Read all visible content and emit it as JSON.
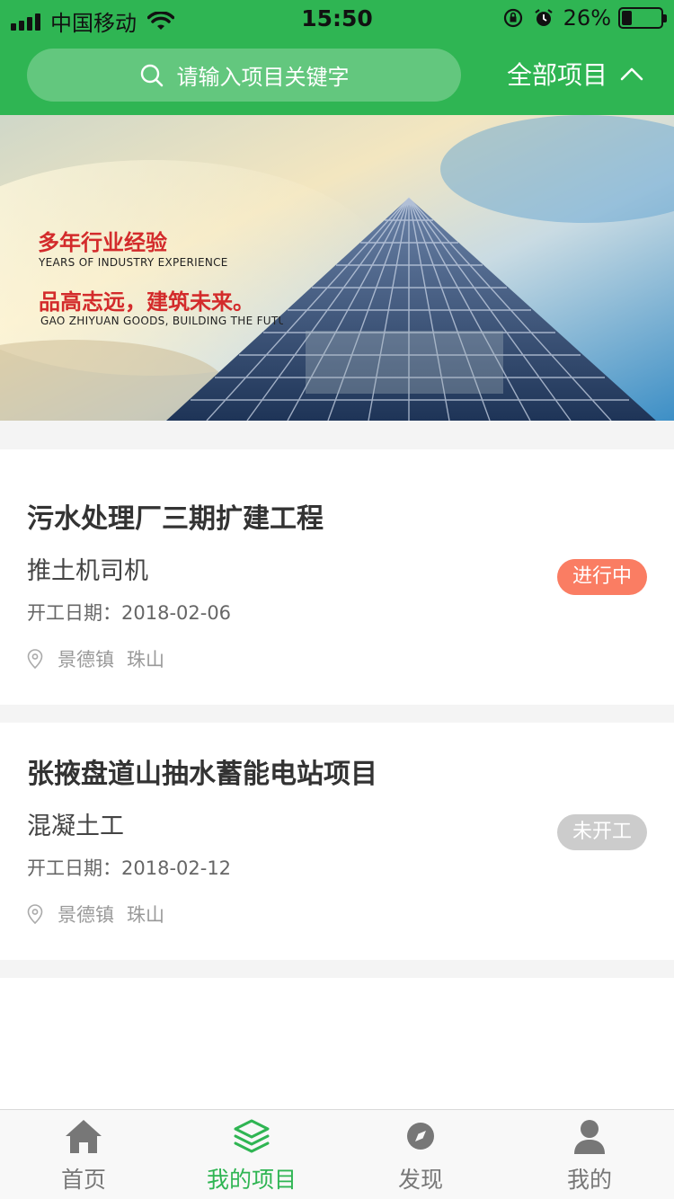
{
  "status_bar": {
    "carrier": "中国移动",
    "time": "15:50",
    "battery": "26%",
    "battery_level": 0.26
  },
  "header": {
    "search_placeholder": "请输入项目关键字",
    "filter_label": "全部项目"
  },
  "banner": {
    "title1": "多年行业经验",
    "sub1": "YEARS OF INDUSTRY EXPERIENCE",
    "title2": "品高志远，建筑未来。",
    "sub2": "GAO ZHIYUAN GOODS, BUILDING THE FUTURE"
  },
  "projects": [
    {
      "title": "污水处理厂三期扩建工程",
      "role": "推土机司机",
      "date": "开工日期：2018-02-06",
      "city": "景德镇",
      "district": "珠山",
      "status": "进行中",
      "status_color": "#fa7d63"
    },
    {
      "title": "张掖盘道山抽水蓄能电站项目",
      "role": "混凝土工",
      "date": "开工日期：2018-02-12",
      "city": "景德镇",
      "district": "珠山",
      "status": "未开工",
      "status_color": "#cccccc"
    }
  ],
  "tabbar": {
    "items": [
      {
        "label": "首页",
        "icon": "home-icon",
        "active": false
      },
      {
        "label": "我的项目",
        "icon": "layers-icon",
        "active": true
      },
      {
        "label": "发现",
        "icon": "compass-icon",
        "active": false
      },
      {
        "label": "我的",
        "icon": "user-icon",
        "active": false
      }
    ],
    "active_color": "#2fb553",
    "inactive_color": "#777777"
  }
}
